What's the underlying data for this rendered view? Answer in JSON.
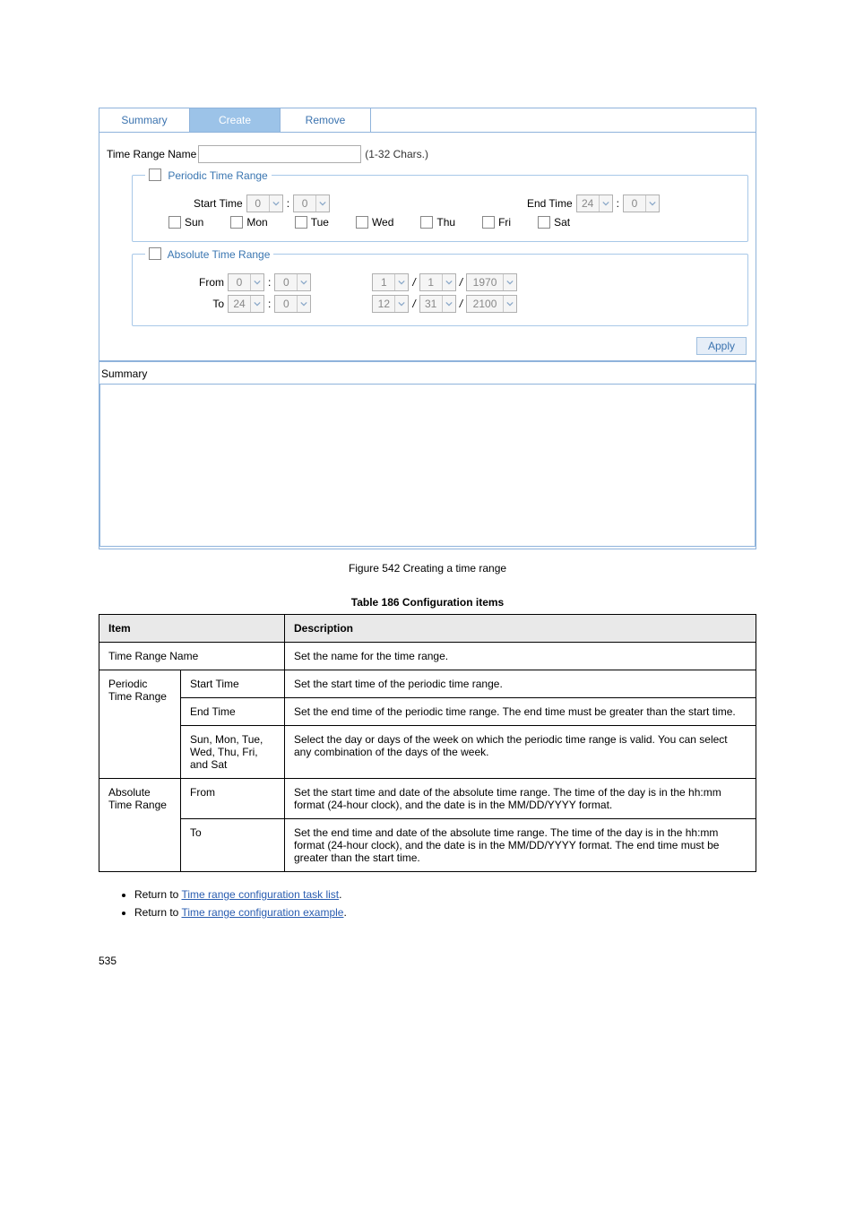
{
  "tabs": {
    "summary": "Summary",
    "create": "Create",
    "remove": "Remove"
  },
  "trname": {
    "label": "Time Range Name",
    "hint": "(1-32 Chars.)"
  },
  "periodic": {
    "legend": "Periodic Time Range",
    "start_label": "Start Time",
    "end_label": "End Time",
    "start_h": "0",
    "start_m": "0",
    "end_h": "24",
    "end_m": "0",
    "days": {
      "sun": "Sun",
      "mon": "Mon",
      "tue": "Tue",
      "wed": "Wed",
      "thu": "Thu",
      "fri": "Fri",
      "sat": "Sat"
    }
  },
  "absolute": {
    "legend": "Absolute Time Range",
    "from_label": "From",
    "to_label": "To",
    "from_h": "0",
    "from_m": "0",
    "from_mo": "1",
    "from_d": "1",
    "from_y": "1970",
    "to_h": "24",
    "to_m": "0",
    "to_mo": "12",
    "to_d": "31",
    "to_y": "2100"
  },
  "apply": "Apply",
  "summary_label": "Summary",
  "figure_caption": "Figure 542 Creating a time range",
  "table_caption": "Table 186 Configuration items",
  "table": {
    "head_item": "Item",
    "head_desc": "Description",
    "rows": [
      {
        "item": "Time Range Name",
        "desc": "Set the name for the time range.",
        "subitem": ""
      },
      {
        "item": "Periodic Time Range",
        "subitem": "Start Time",
        "desc": "Set the start time of the periodic time range."
      },
      {
        "item": "",
        "subitem": "End Time",
        "desc": "Set the end time of the periodic time range. The end time must be greater than the start time."
      },
      {
        "item": "",
        "subitem": "Sun, Mon, Tue, Wed, Thu, Fri, and Sat",
        "desc": "Select the day or days of the week on which the periodic time range is valid. You can select any combination of the days of the week."
      },
      {
        "item": "Absolute Time Range",
        "subitem": "From",
        "desc": "Set the start time and date of the absolute time range. The time of the day is in the hh:mm format (24-hour clock), and the date is in the MM/DD/YYYY format."
      },
      {
        "item": "",
        "subitem": "To",
        "desc": "Set the end time and date of the absolute time range. The time of the day is in the hh:mm format (24-hour clock), and the date is in the MM/DD/YYYY format. The end time must be greater than the start time."
      }
    ]
  },
  "return": {
    "lead": "Return to",
    "link1": "Time range configuration task list",
    "link2": "Time range configuration example"
  },
  "footer": "535"
}
